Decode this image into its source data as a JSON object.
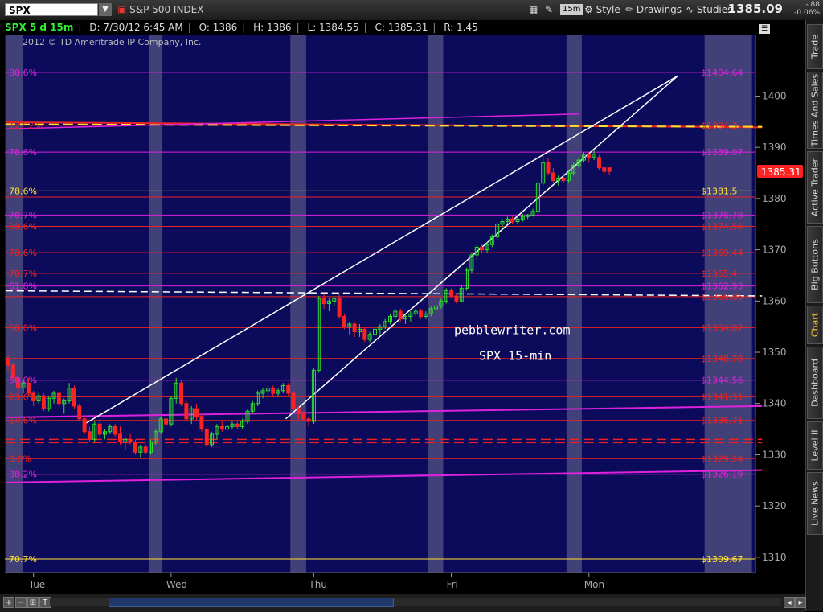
{
  "toolbar": {
    "symbol": "SPX",
    "symbol_name": "S&P 500 INDEX",
    "interval": "15m",
    "style_label": "Style",
    "drawings_label": "Drawings",
    "studies_label": "Studies",
    "last_price": "1385.09",
    "change_points": "-.88",
    "change_pct": "-0.06%"
  },
  "infobar": {
    "chart_spec": "SPX 5 d 15m",
    "date": "D: 7/30/12 6:45 AM",
    "open": "O: 1386",
    "high": "H: 1386",
    "low": "L: 1384.55",
    "close": "C: 1385.31",
    "range": "R: 1.45",
    "copyright": "2012 © TD Ameritrade IP Company, Inc."
  },
  "sidebar": {
    "tabs": [
      "Trade",
      "Times And Sales",
      "Active Trader",
      "Big Buttons",
      "Chart",
      "Dashboard",
      "Level II",
      "Live News"
    ]
  },
  "bottombar": {
    "buttons": [
      "+",
      "−",
      "⊞",
      "T"
    ]
  },
  "chart_data": {
    "type": "candlestick",
    "symbol": "SPX",
    "interval": "15-min",
    "ylim": [
      1307,
      1412
    ],
    "y_ticks": [
      1310,
      1320,
      1330,
      1340,
      1350,
      1360,
      1370,
      1380,
      1390,
      1400
    ],
    "x_labels": [
      "Tue",
      "Wed",
      "Thu",
      "Fri",
      "Mon"
    ],
    "current_price": 1385.31,
    "colors": {
      "background": "#0c0a5a",
      "session_band": "#4b4a7e",
      "up": "#2ee02e",
      "down": "#ff2222",
      "fib_magenta": "#dd22dd",
      "fib_red": "#ee2222",
      "yellow": "#ffe033",
      "white": "#ffffff",
      "price_tag": "#ff2222"
    },
    "levels": [
      {
        "price": 1404.64,
        "label": "$1404.64",
        "pct": "88.6%",
        "color": "magenta"
      },
      {
        "price": 1394.3,
        "label": "$1394.3",
        "pct": "127.2%",
        "color": "red"
      },
      {
        "price": 1389.07,
        "label": "$1389.07",
        "pct": "78.6%",
        "color": "magenta"
      },
      {
        "price": 1381.5,
        "label": "$1381.5",
        "pct": "78.6%",
        "color": "yellow"
      },
      {
        "price": 1380.3,
        "label": "",
        "pct": "",
        "color": "red"
      },
      {
        "price": 1376.78,
        "label": "$1376.78",
        "pct": "70.7%",
        "color": "magenta"
      },
      {
        "price": 1374.56,
        "label": "$1374.56",
        "pct": "88.6%",
        "color": "red"
      },
      {
        "price": 1369.44,
        "label": "$1369.44",
        "pct": "78.6%",
        "color": "red"
      },
      {
        "price": 1365.4,
        "label": "$1365.4",
        "pct": "70.7%",
        "color": "red"
      },
      {
        "price": 1362.93,
        "label": "$1362.93",
        "pct": "61.8%",
        "color": "magenta"
      },
      {
        "price": 1360.85,
        "label": "$1360.85",
        "pct": "",
        "color": "red"
      },
      {
        "price": 1354.82,
        "label": "$1354.82",
        "pct": "50.0%",
        "color": "red"
      },
      {
        "price": 1348.78,
        "label": "$1348.78",
        "pct": "",
        "color": "red"
      },
      {
        "price": 1344.56,
        "label": "$1344.56",
        "pct": "50.0%",
        "color": "magenta"
      },
      {
        "price": 1341.31,
        "label": "$1341.31",
        "pct": "23.6%",
        "color": "red"
      },
      {
        "price": 1336.71,
        "label": "$1336.71",
        "pct": "14.6%",
        "color": "red"
      },
      {
        "price": 1329.24,
        "label": "$1329.24",
        "pct": "0.0%",
        "color": "red"
      },
      {
        "price": 1326.19,
        "label": "$1326.19",
        "pct": "38.2%",
        "color": "magenta"
      },
      {
        "price": 1309.67,
        "label": "$1309.67",
        "pct": "70.7%",
        "color": "yellow"
      }
    ],
    "annotations": [
      "pebblewriter.com",
      "SPX 15-min"
    ],
    "candles": [
      [
        1348.5,
        1349.5,
        1346.5,
        1347.5
      ],
      [
        1347.5,
        1348.0,
        1344.5,
        1345.0
      ],
      [
        1345.0,
        1345.5,
        1342.0,
        1343.0
      ],
      [
        1343.0,
        1344.5,
        1342.0,
        1344.0
      ],
      [
        1344.0,
        1345.0,
        1341.5,
        1342.0
      ],
      [
        1342.0,
        1342.5,
        1339.5,
        1340.5
      ],
      [
        1340.5,
        1342.0,
        1340.0,
        1341.5
      ],
      [
        1341.5,
        1342.0,
        1338.5,
        1339.0
      ],
      [
        1339.0,
        1341.5,
        1338.5,
        1341.0
      ],
      [
        1341.0,
        1342.5,
        1340.0,
        1342.0
      ],
      [
        1342.0,
        1342.5,
        1339.5,
        1340.0
      ],
      [
        1340.0,
        1341.0,
        1338.0,
        1340.5
      ],
      [
        1340.5,
        1344.0,
        1340.0,
        1343.0
      ],
      [
        1343.0,
        1343.5,
        1339.0,
        1339.5
      ],
      [
        1339.5,
        1340.0,
        1336.5,
        1337.0
      ],
      [
        1337.0,
        1337.5,
        1334.0,
        1334.5
      ],
      [
        1334.5,
        1335.5,
        1332.5,
        1333.0
      ],
      [
        1333.0,
        1336.5,
        1332.5,
        1336.0
      ],
      [
        1336.0,
        1337.0,
        1333.5,
        1334.0
      ],
      [
        1334.0,
        1335.0,
        1333.0,
        1334.5
      ],
      [
        1334.5,
        1336.0,
        1334.0,
        1335.5
      ],
      [
        1335.5,
        1336.0,
        1333.5,
        1334.0
      ],
      [
        1334.0,
        1335.5,
        1332.0,
        1332.5
      ],
      [
        1332.5,
        1333.5,
        1331.0,
        1333.0
      ],
      [
        1333.0,
        1334.0,
        1332.0,
        1332.5
      ],
      [
        1332.5,
        1333.0,
        1330.0,
        1330.5
      ],
      [
        1330.5,
        1332.0,
        1329.5,
        1331.5
      ],
      [
        1331.5,
        1332.0,
        1330.0,
        1330.5
      ],
      [
        1330.5,
        1333.0,
        1330.0,
        1332.5
      ],
      [
        1332.5,
        1335.0,
        1332.0,
        1334.5
      ],
      [
        1334.5,
        1337.5,
        1334.0,
        1337.0
      ],
      [
        1337.0,
        1338.0,
        1335.5,
        1336.0
      ],
      [
        1336.0,
        1341.5,
        1335.5,
        1341.0
      ],
      [
        1341.0,
        1345.0,
        1340.0,
        1344.0
      ],
      [
        1344.0,
        1344.5,
        1339.5,
        1340.0
      ],
      [
        1340.0,
        1340.5,
        1336.5,
        1337.0
      ],
      [
        1337.0,
        1339.5,
        1336.0,
        1339.0
      ],
      [
        1339.0,
        1340.0,
        1336.5,
        1337.5
      ],
      [
        1337.5,
        1338.0,
        1334.5,
        1335.0
      ],
      [
        1335.0,
        1335.5,
        1331.5,
        1332.0
      ],
      [
        1332.0,
        1334.5,
        1331.5,
        1334.0
      ],
      [
        1334.0,
        1336.0,
        1333.0,
        1335.5
      ],
      [
        1335.5,
        1336.5,
        1334.5,
        1335.0
      ],
      [
        1335.0,
        1336.0,
        1334.5,
        1335.5
      ],
      [
        1335.5,
        1336.5,
        1335.0,
        1336.0
      ],
      [
        1336.0,
        1336.5,
        1335.0,
        1335.5
      ],
      [
        1335.5,
        1337.0,
        1335.0,
        1336.5
      ],
      [
        1336.5,
        1339.0,
        1336.0,
        1338.5
      ],
      [
        1338.5,
        1340.5,
        1338.0,
        1340.0
      ],
      [
        1340.0,
        1342.5,
        1339.5,
        1342.0
      ],
      [
        1342.0,
        1343.0,
        1341.0,
        1342.5
      ],
      [
        1342.5,
        1343.5,
        1341.5,
        1343.0
      ],
      [
        1343.0,
        1343.5,
        1341.5,
        1342.0
      ],
      [
        1342.0,
        1343.0,
        1341.5,
        1342.5
      ],
      [
        1342.5,
        1344.0,
        1342.0,
        1343.5
      ],
      [
        1343.5,
        1344.0,
        1341.5,
        1342.0
      ],
      [
        1342.0,
        1342.5,
        1338.5,
        1339.0
      ],
      [
        1339.0,
        1339.5,
        1337.0,
        1338.0
      ],
      [
        1338.0,
        1338.5,
        1336.5,
        1337.0
      ],
      [
        1337.0,
        1337.5,
        1335.5,
        1336.5
      ],
      [
        1336.5,
        1347.0,
        1336.0,
        1346.5
      ],
      [
        1346.5,
        1361.0,
        1346.0,
        1360.5
      ],
      [
        1360.5,
        1361.5,
        1358.5,
        1359.5
      ],
      [
        1359.5,
        1360.5,
        1358.0,
        1360.0
      ],
      [
        1360.0,
        1361.0,
        1359.0,
        1360.5
      ],
      [
        1360.5,
        1361.5,
        1356.5,
        1357.0
      ],
      [
        1357.0,
        1357.5,
        1354.5,
        1355.0
      ],
      [
        1355.0,
        1356.0,
        1353.5,
        1355.5
      ],
      [
        1355.5,
        1356.0,
        1353.0,
        1354.0
      ],
      [
        1354.0,
        1355.5,
        1353.0,
        1354.5
      ],
      [
        1354.5,
        1355.0,
        1352.0,
        1352.5
      ],
      [
        1352.5,
        1354.0,
        1352.0,
        1353.5
      ],
      [
        1353.5,
        1355.0,
        1353.0,
        1354.5
      ],
      [
        1354.5,
        1355.5,
        1353.5,
        1355.0
      ],
      [
        1355.0,
        1356.5,
        1354.5,
        1356.0
      ],
      [
        1356.0,
        1357.5,
        1355.5,
        1357.0
      ],
      [
        1357.0,
        1358.5,
        1356.5,
        1358.0
      ],
      [
        1358.0,
        1358.5,
        1356.0,
        1356.5
      ],
      [
        1356.5,
        1357.5,
        1355.5,
        1357.0
      ],
      [
        1357.0,
        1358.0,
        1356.0,
        1357.5
      ],
      [
        1357.5,
        1358.5,
        1357.0,
        1358.0
      ],
      [
        1358.0,
        1358.5,
        1356.5,
        1357.0
      ],
      [
        1357.0,
        1358.0,
        1356.5,
        1357.5
      ],
      [
        1357.5,
        1359.0,
        1357.0,
        1358.5
      ],
      [
        1358.5,
        1359.5,
        1358.0,
        1359.0
      ],
      [
        1359.0,
        1360.5,
        1358.5,
        1360.0
      ],
      [
        1360.0,
        1362.5,
        1359.5,
        1362.0
      ],
      [
        1362.0,
        1362.5,
        1360.5,
        1361.0
      ],
      [
        1361.0,
        1361.5,
        1359.5,
        1360.0
      ],
      [
        1360.0,
        1363.0,
        1360.0,
        1362.5
      ],
      [
        1362.5,
        1366.5,
        1362.0,
        1366.0
      ],
      [
        1366.0,
        1369.5,
        1365.5,
        1369.0
      ],
      [
        1369.0,
        1371.0,
        1368.0,
        1370.5
      ],
      [
        1370.5,
        1371.0,
        1369.5,
        1370.0
      ],
      [
        1370.0,
        1371.5,
        1369.5,
        1371.0
      ],
      [
        1371.0,
        1373.0,
        1370.5,
        1372.5
      ],
      [
        1372.5,
        1375.5,
        1372.0,
        1375.0
      ],
      [
        1375.0,
        1376.0,
        1374.0,
        1375.5
      ],
      [
        1375.5,
        1376.5,
        1375.0,
        1376.0
      ],
      [
        1376.0,
        1376.5,
        1375.0,
        1375.5
      ],
      [
        1375.5,
        1376.5,
        1375.0,
        1376.0
      ],
      [
        1376.0,
        1377.0,
        1375.5,
        1376.5
      ],
      [
        1376.5,
        1377.0,
        1376.0,
        1376.8
      ],
      [
        1376.8,
        1378.0,
        1376.5,
        1377.5
      ],
      [
        1377.5,
        1383.5,
        1377.0,
        1383.0
      ],
      [
        1383.0,
        1389.0,
        1382.5,
        1387.0
      ],
      [
        1387.0,
        1388.0,
        1384.5,
        1385.0
      ],
      [
        1385.0,
        1386.0,
        1383.0,
        1383.5
      ],
      [
        1383.5,
        1384.5,
        1382.5,
        1384.0
      ],
      [
        1384.0,
        1385.0,
        1383.0,
        1383.5
      ],
      [
        1383.5,
        1385.5,
        1383.0,
        1385.0
      ],
      [
        1385.0,
        1387.0,
        1384.5,
        1386.5
      ],
      [
        1386.5,
        1388.0,
        1386.0,
        1387.5
      ],
      [
        1387.5,
        1389.0,
        1387.0,
        1388.5
      ],
      [
        1388.5,
        1389.0,
        1387.0,
        1388.0
      ],
      [
        1388.0,
        1389.5,
        1387.5,
        1388.7
      ],
      [
        1388.0,
        1388.5,
        1385.5,
        1386.0
      ],
      [
        1386.0,
        1386.0,
        1384.5,
        1385.3
      ],
      [
        1386.0,
        1386.0,
        1384.55,
        1385.31
      ]
    ]
  }
}
